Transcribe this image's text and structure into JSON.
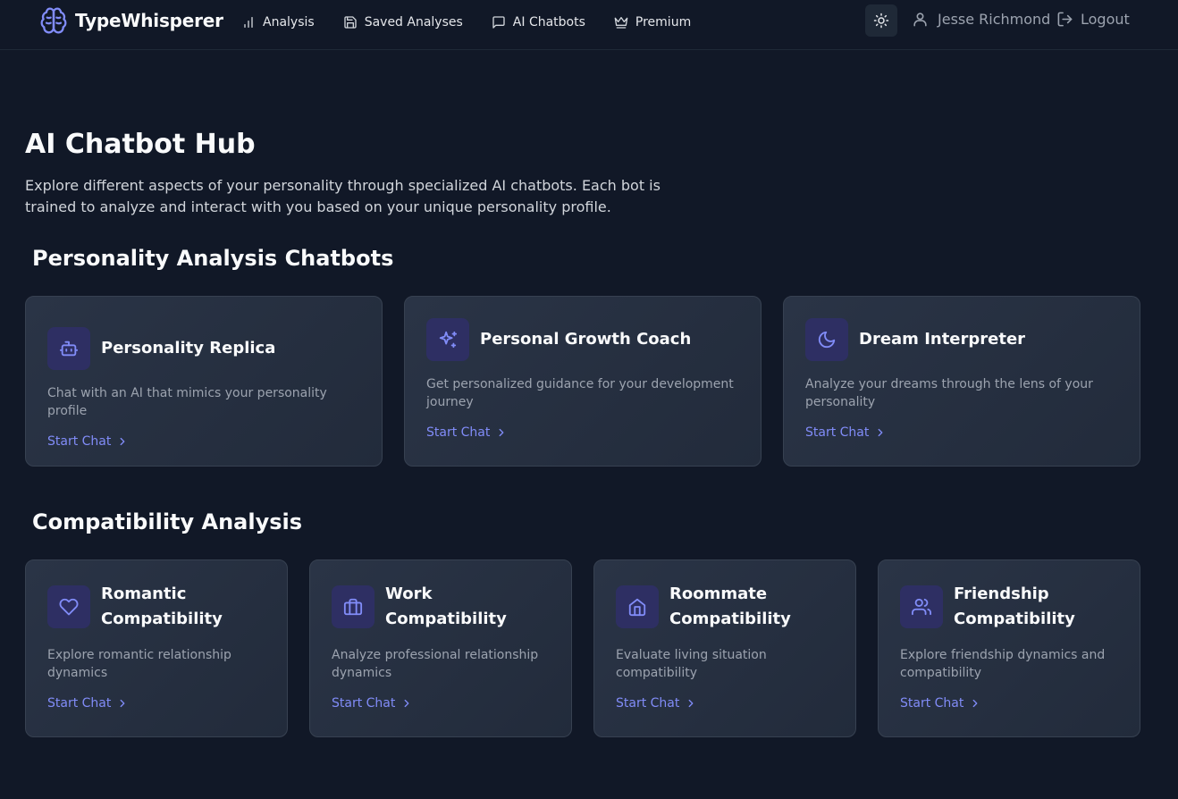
{
  "app": {
    "name": "TypeWhisperer",
    "logo_icon": "brain-icon"
  },
  "nav": {
    "links": [
      {
        "label": "Analysis",
        "icon": "bar-chart-icon"
      },
      {
        "label": "Saved Analyses",
        "icon": "save-icon"
      },
      {
        "label": "AI Chatbots",
        "icon": "message-square-icon"
      },
      {
        "label": "Premium",
        "icon": "crown-icon"
      }
    ],
    "theme_icon": "sun-icon",
    "user_name": "Jesse Richmond",
    "logout_label": "Logout"
  },
  "page": {
    "title": "AI Chatbot Hub",
    "description": "Explore different aspects of your personality through specialized AI chatbots. Each bot is trained to analyze and interact with you based on your unique personality profile."
  },
  "sections": [
    {
      "title": "Personality Analysis Chatbots",
      "cards": [
        {
          "title": "Personality Replica",
          "description": "Chat with an AI that mimics your personality profile",
          "link": "Start Chat",
          "icon": "bot-icon"
        },
        {
          "title": "Personal Growth Coach",
          "description": "Get personalized guidance for your development journey",
          "link": "Start Chat",
          "icon": "sparkles-icon"
        },
        {
          "title": "Dream Interpreter",
          "description": "Analyze your dreams through the lens of your personality",
          "link": "Start Chat",
          "icon": "moon-icon"
        }
      ]
    },
    {
      "title": "Compatibility Analysis",
      "cards": [
        {
          "title": "Romantic Compatibility",
          "description": "Explore romantic relationship dynamics",
          "link": "Start Chat",
          "icon": "heart-icon"
        },
        {
          "title": "Work Compatibility",
          "description": "Analyze professional relationship dynamics",
          "link": "Start Chat",
          "icon": "briefcase-icon"
        },
        {
          "title": "Roommate Compatibility",
          "description": "Evaluate living situation compatibility",
          "link": "Start Chat",
          "icon": "home-icon"
        },
        {
          "title": "Friendship Compatibility",
          "description": "Explore friendship dynamics and compatibility",
          "link": "Start Chat",
          "icon": "users-icon"
        }
      ]
    }
  ],
  "colors": {
    "background": "#111827",
    "accent": "#818cf8",
    "card_border": "#374151"
  }
}
